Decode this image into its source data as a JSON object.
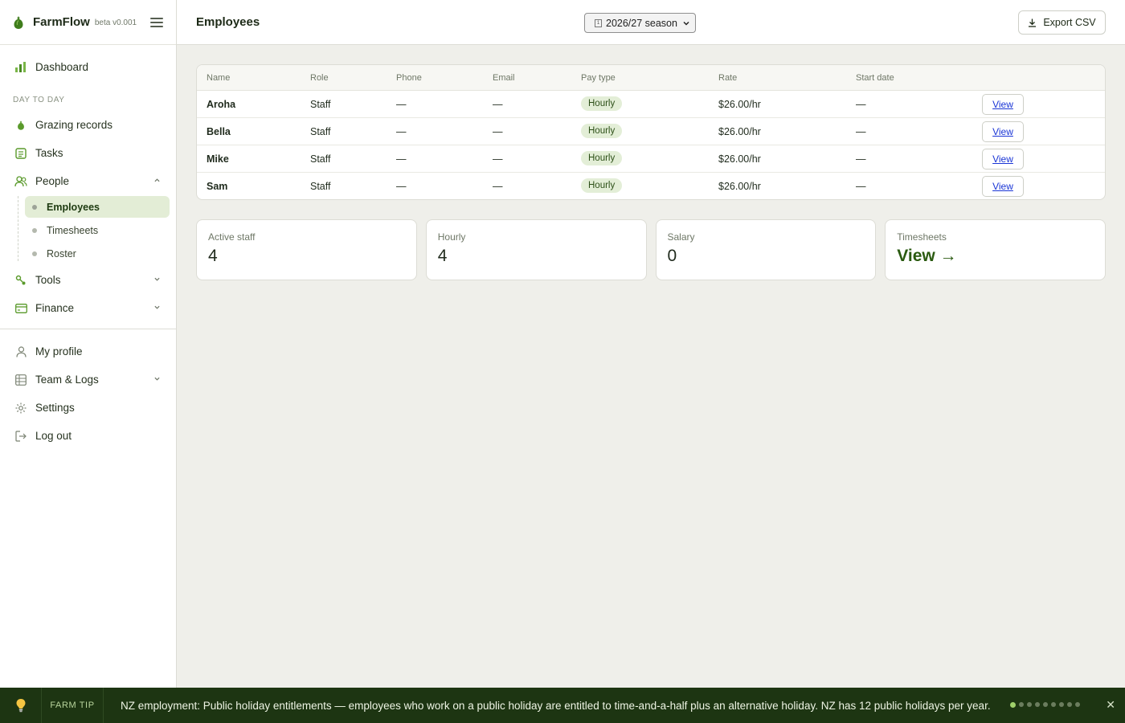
{
  "brand": {
    "name": "FarmFlow",
    "beta": "beta v0.001"
  },
  "sidebar": {
    "dashboard": "Dashboard",
    "section_label": "DAY TO DAY",
    "grazing": "Grazing records",
    "tasks": "Tasks",
    "people": "People",
    "people_sub": [
      "Employees",
      "Timesheets",
      "Roster"
    ],
    "tools": "Tools",
    "finance": "Finance",
    "my_profile": "My profile",
    "team_logs": "Team & Logs",
    "settings": "Settings",
    "logout": "Log out"
  },
  "header": {
    "title": "Employees",
    "season": "2026/27 season",
    "export": "Export CSV"
  },
  "table": {
    "columns": [
      "Name",
      "Role",
      "Phone",
      "Email",
      "Pay type",
      "Rate",
      "Start date"
    ],
    "rows": [
      {
        "name": "Aroha",
        "role": "Staff",
        "phone": "—",
        "email": "—",
        "pay": "Hourly",
        "rate": "$26.00/hr",
        "start": "—",
        "action": "View"
      },
      {
        "name": "Bella",
        "role": "Staff",
        "phone": "—",
        "email": "—",
        "pay": "Hourly",
        "rate": "$26.00/hr",
        "start": "—",
        "action": "View"
      },
      {
        "name": "Mike",
        "role": "Staff",
        "phone": "—",
        "email": "—",
        "pay": "Hourly",
        "rate": "$26.00/hr",
        "start": "—",
        "action": "View"
      },
      {
        "name": "Sam",
        "role": "Staff",
        "phone": "—",
        "email": "—",
        "pay": "Hourly",
        "rate": "$26.00/hr",
        "start": "—",
        "action": "View"
      }
    ]
  },
  "stats": {
    "active_label": "Active staff",
    "active_value": "4",
    "hourly_label": "Hourly",
    "hourly_value": "4",
    "salary_label": "Salary",
    "salary_value": "0",
    "timesheets_label": "Timesheets",
    "timesheets_link": "View →"
  },
  "tip": {
    "label": "FARM TIP",
    "text": "NZ employment: Public holiday entitlements — employees who work on a public holiday are entitled to time-and-a-half plus an alternative holiday. NZ has 12 public holidays per year.",
    "close": "✕",
    "active_dot": 1,
    "dot_count": 9
  },
  "colors": {
    "accent": "#5a9a2b",
    "tip_bar": "#1d3512",
    "badge_bg": "#e3eed7",
    "active_nav_bg": "#e3edd6"
  }
}
